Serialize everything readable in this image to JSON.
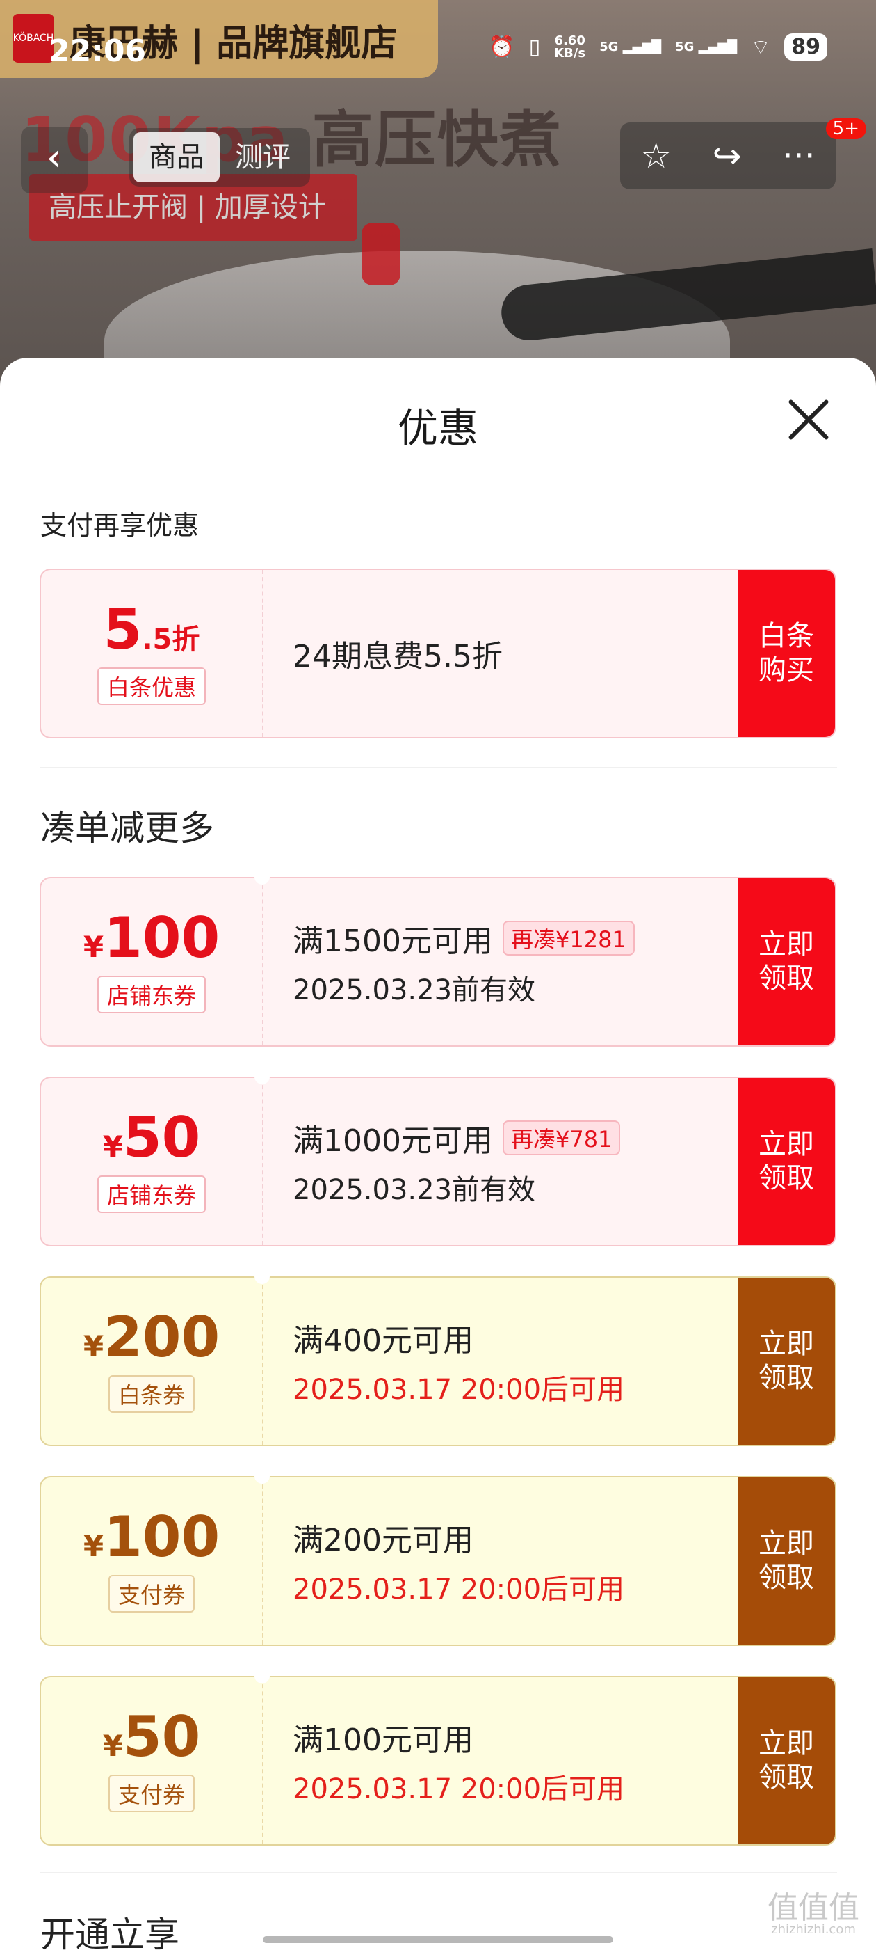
{
  "background": {
    "brand_logo_text": "KÖBACH",
    "brand_name": "康巴赫 | 品牌旗舰店",
    "headline_prefix": "100Kpa",
    "headline_suffix": "高压快煮",
    "subtag": "高压止开阀 | 加厚设计"
  },
  "status_bar": {
    "time": "22:06",
    "net_speed_value": "6.60",
    "net_speed_unit": "KB/s",
    "signal1": "5G",
    "signal2": "5G",
    "battery": "89"
  },
  "nav": {
    "back_icon": "‹",
    "tabs": [
      "商品",
      "测评"
    ],
    "star_icon": "☆",
    "share_icon": "↪",
    "more_icon": "···",
    "badge": "5+"
  },
  "sheet": {
    "title": "优惠",
    "section1": "支付再享优惠",
    "section2": "凑单减更多",
    "section3": "开通立享"
  },
  "cards": [
    {
      "amount": "5",
      "suffix": ".5折",
      "currency": "",
      "tag": "白条优惠",
      "line1": "24期息费5.5折",
      "chip": "",
      "line2": "",
      "button": "白条\n购买",
      "theme": "red"
    },
    {
      "amount": "100",
      "suffix": "",
      "currency": "¥",
      "tag": "店铺东券",
      "line1": "满1500元可用",
      "chip": "再凑¥1281",
      "line2": "2025.03.23前有效",
      "button": "立即\n领取",
      "theme": "red"
    },
    {
      "amount": "50",
      "suffix": "",
      "currency": "¥",
      "tag": "店铺东券",
      "line1": "满1000元可用",
      "chip": "再凑¥781",
      "line2": "2025.03.23前有效",
      "button": "立即\n领取",
      "theme": "red"
    },
    {
      "amount": "200",
      "suffix": "",
      "currency": "¥",
      "tag": "白条券",
      "line1": "满400元可用",
      "chip": "",
      "line2": "2025.03.17 20:00后可用",
      "button": "立即\n领取",
      "theme": "yellow"
    },
    {
      "amount": "100",
      "suffix": "",
      "currency": "¥",
      "tag": "支付券",
      "line1": "满200元可用",
      "chip": "",
      "line2": "2025.03.17 20:00后可用",
      "button": "立即\n领取",
      "theme": "yellow"
    },
    {
      "amount": "50",
      "suffix": "",
      "currency": "¥",
      "tag": "支付券",
      "line1": "满100元可用",
      "chip": "",
      "line2": "2025.03.17 20:00后可用",
      "button": "立即\n领取",
      "theme": "yellow"
    }
  ],
  "watermark": {
    "main": "值值值",
    "sub": "zhizhizhi.com"
  }
}
